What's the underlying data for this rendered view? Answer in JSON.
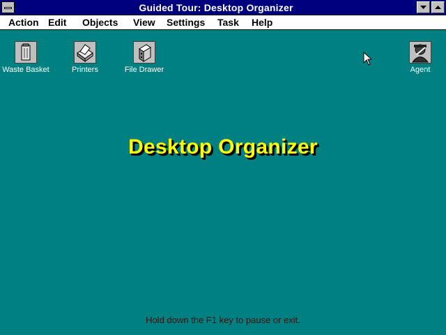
{
  "window": {
    "title": "Guided Tour: Desktop Organizer"
  },
  "menu": [
    {
      "label": "Action"
    },
    {
      "label": "Edit"
    },
    {
      "label": "Objects"
    },
    {
      "label": "View"
    },
    {
      "label": "Settings"
    },
    {
      "label": "Task"
    },
    {
      "label": "Help"
    }
  ],
  "icons": {
    "waste_basket": {
      "label": "Waste Basket",
      "icon": "waste-basket-icon"
    },
    "printers": {
      "label": "Printers",
      "icon": "printer-icon"
    },
    "file_drawer": {
      "label": "File Drawer",
      "icon": "file-drawer-icon"
    },
    "agent": {
      "label": "Agent",
      "icon": "agent-icon"
    }
  },
  "banner": "Desktop Organizer",
  "hint": "Hold down the F1 key to pause or exit.",
  "colors": {
    "desktop": "#008080",
    "titlebar": "#00007f",
    "banner": "#ffff00"
  }
}
